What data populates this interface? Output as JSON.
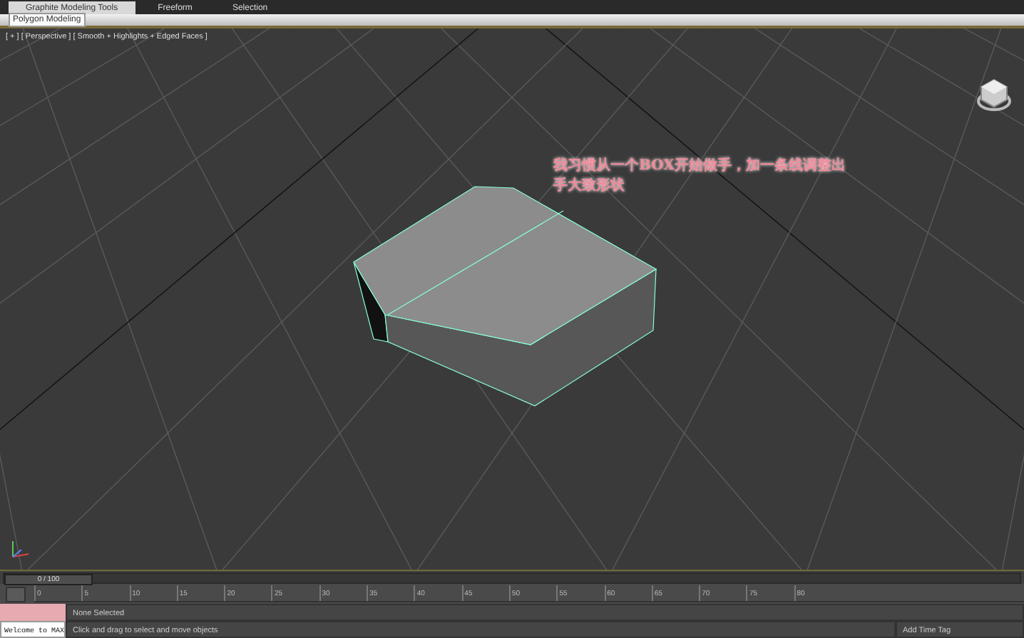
{
  "ribbon_tabs": [
    {
      "label": "Graphite Modeling Tools",
      "selected": true
    },
    {
      "label": "Freeform",
      "selected": false
    },
    {
      "label": "Selection",
      "selected": false
    }
  ],
  "ribbon_panel": {
    "label": "Polygon Modeling"
  },
  "viewport": {
    "label": "[ + ] [ Perspective ] [ Smooth + Highlights + Edged Faces ]",
    "annotation": [
      "我习惯从一个BOX开始做手，加一条线调整出",
      "手大致形状"
    ]
  },
  "time_slider": {
    "reading": "0 / 100",
    "level": 0
  },
  "track_bar": {
    "ticks": [
      "0",
      "5",
      "10",
      "15",
      "20",
      "25",
      "30",
      "35",
      "40",
      "45",
      "50",
      "55",
      "60",
      "65",
      "70",
      "75",
      "80"
    ]
  },
  "status_bar": {
    "maxscript": "Welcome to MAX",
    "selection": "None Selected",
    "prompt": "Click and drag to select and move objects",
    "time_tag": "Add Time Tag"
  }
}
